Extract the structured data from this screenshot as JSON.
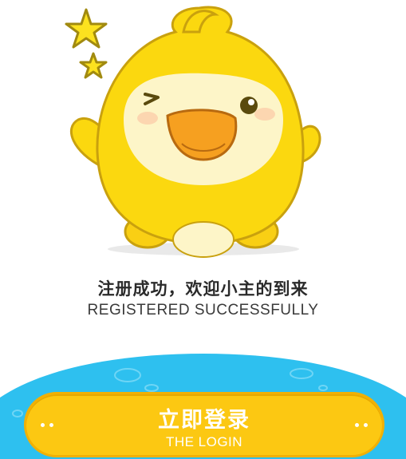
{
  "message": {
    "title_cn": "注册成功，欢迎小主的到来",
    "title_en": "REGISTERED SUCCESSFULLY"
  },
  "login_button": {
    "label_cn": "立即登录",
    "label_en": "THE LOGIN"
  },
  "colors": {
    "mascot_yellow": "#fbd80f",
    "button_yellow": "#fcc812",
    "wave_blue": "#2ec0ef"
  },
  "icons": {
    "mascot": "winking-chick-mascot",
    "stars": "star-icon"
  }
}
